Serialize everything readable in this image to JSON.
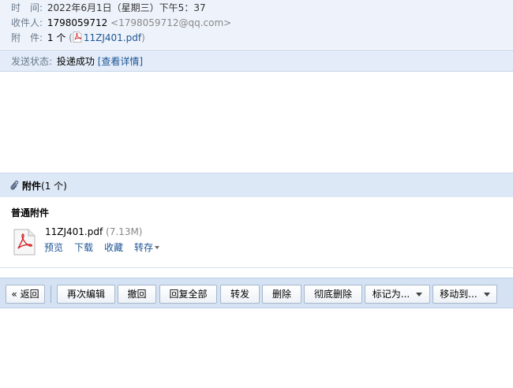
{
  "header": {
    "time_label": "时　间:",
    "time_value": "2022年6月1日（星期三）下午5：37",
    "recipient_label": "收件人:",
    "recipient_name": "1798059712",
    "recipient_email": "<1798059712@qq.com>",
    "attachment_label": "附　件:",
    "attachment_count": "1 个",
    "attachment_open_paren": "(",
    "attachment_file": "11ZJ401.pdf",
    "attachment_close_paren": ")"
  },
  "status": {
    "label": "发送状态:",
    "value": "投递成功",
    "details_link": "[查看详情]"
  },
  "attachments": {
    "title": "附件",
    "count": "(1 个)",
    "section_label": "普通附件",
    "file": {
      "name": "11ZJ401.pdf",
      "size": "(7.13M)",
      "actions": [
        "预览",
        "下载",
        "收藏",
        "转存"
      ]
    }
  },
  "toolbar": {
    "back": "« 返回",
    "re_edit": "再次编辑",
    "recall": "撤回",
    "reply_all": "回复全部",
    "forward": "转发",
    "delete": "删除",
    "delete_permanently": "彻底删除",
    "mark_as": "标记为...",
    "move_to": "移动到..."
  },
  "icons": {
    "pdf": "pdf-file-icon",
    "clip": "paperclip-icon"
  }
}
